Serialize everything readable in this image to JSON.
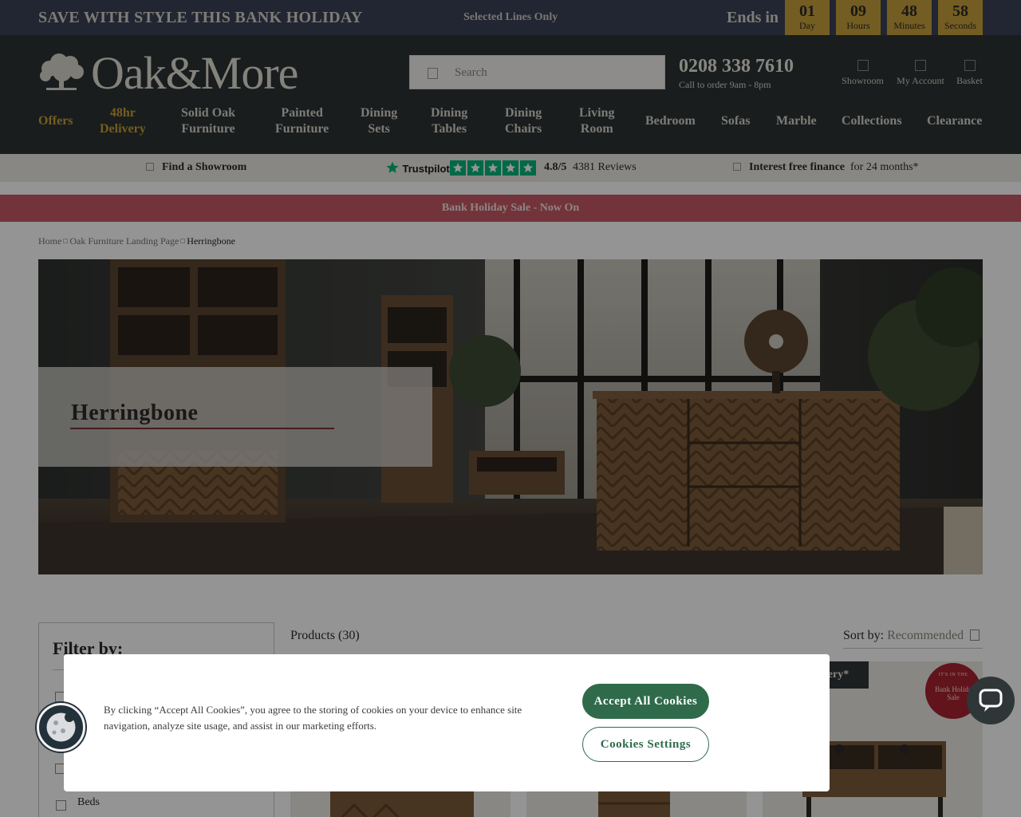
{
  "promo": {
    "headline": "SAVE WITH STYLE THIS BANK HOLIDAY",
    "selected_lines": "Selected Lines Only",
    "ends_in": "Ends in",
    "countdown": [
      {
        "value": "01",
        "unit": "Day"
      },
      {
        "value": "09",
        "unit": "Hours"
      },
      {
        "value": "48",
        "unit": "Minutes"
      },
      {
        "value": "58",
        "unit": "Seconds"
      }
    ]
  },
  "header": {
    "logo_text": "Oak&More",
    "search_placeholder": "Search",
    "phone": "0208 338 7610",
    "phone_sub": "Call to order 9am - 8pm",
    "icons": [
      {
        "label": "Showroom",
        "icon": "store-icon"
      },
      {
        "label": "My Account",
        "icon": "user-icon"
      },
      {
        "label": "Basket",
        "icon": "basket-icon"
      }
    ]
  },
  "nav": [
    {
      "line1": "Offers",
      "line2": ""
    },
    {
      "line1": "48hr",
      "line2": "Delivery"
    },
    {
      "line1": "Solid Oak",
      "line2": "Furniture"
    },
    {
      "line1": "Painted",
      "line2": "Furniture"
    },
    {
      "line1": "Dining",
      "line2": "Sets"
    },
    {
      "line1": "Dining",
      "line2": "Tables"
    },
    {
      "line1": "Dining",
      "line2": "Chairs"
    },
    {
      "line1": "Living",
      "line2": "Room"
    },
    {
      "line1": "Bedroom",
      "line2": ""
    },
    {
      "line1": "Sofas",
      "line2": ""
    },
    {
      "line1": "Marble",
      "line2": ""
    },
    {
      "line1": "Collections",
      "line2": ""
    },
    {
      "line1": "Clearance",
      "line2": ""
    }
  ],
  "trust": {
    "showroom": "Find a Showroom",
    "trustpilot": "Trustpilot",
    "rating": "4.8/5",
    "reviews": "4381 Reviews",
    "finance_bold": "Interest free finance",
    "finance_rest": "for 24 months*"
  },
  "banner": "Bank Holiday Sale - Now On",
  "breadcrumb": [
    "Home",
    "Oak Furniture Landing Page",
    "Herringbone"
  ],
  "hero": {
    "title": "Herringbone"
  },
  "filter": {
    "title": "Filter by:",
    "visible_item": "Beds"
  },
  "products": {
    "count": "Products (30)",
    "sort_label": "Sort by:",
    "sort_value": "Recommended",
    "badge": "livery*",
    "seal_top": "IT'S IN THE",
    "seal_line1": "Bank Holida",
    "seal_line2": "Sale"
  },
  "cookie": {
    "text": "By clicking “Accept All Cookies”, you agree to the storing of cookies on your device to enhance site navigation, analyze site usage, and assist in our marketing efforts.",
    "accept": "Accept All Cookies",
    "settings": "Cookies Settings"
  },
  "colors": {
    "promo_bg": "#3b4256",
    "header_bg": "#2b3233",
    "gold": "#c9a13b",
    "banner_red": "#c45a64",
    "cookie_green": "#2f6b4b",
    "trustpilot_green": "#00b67a"
  }
}
